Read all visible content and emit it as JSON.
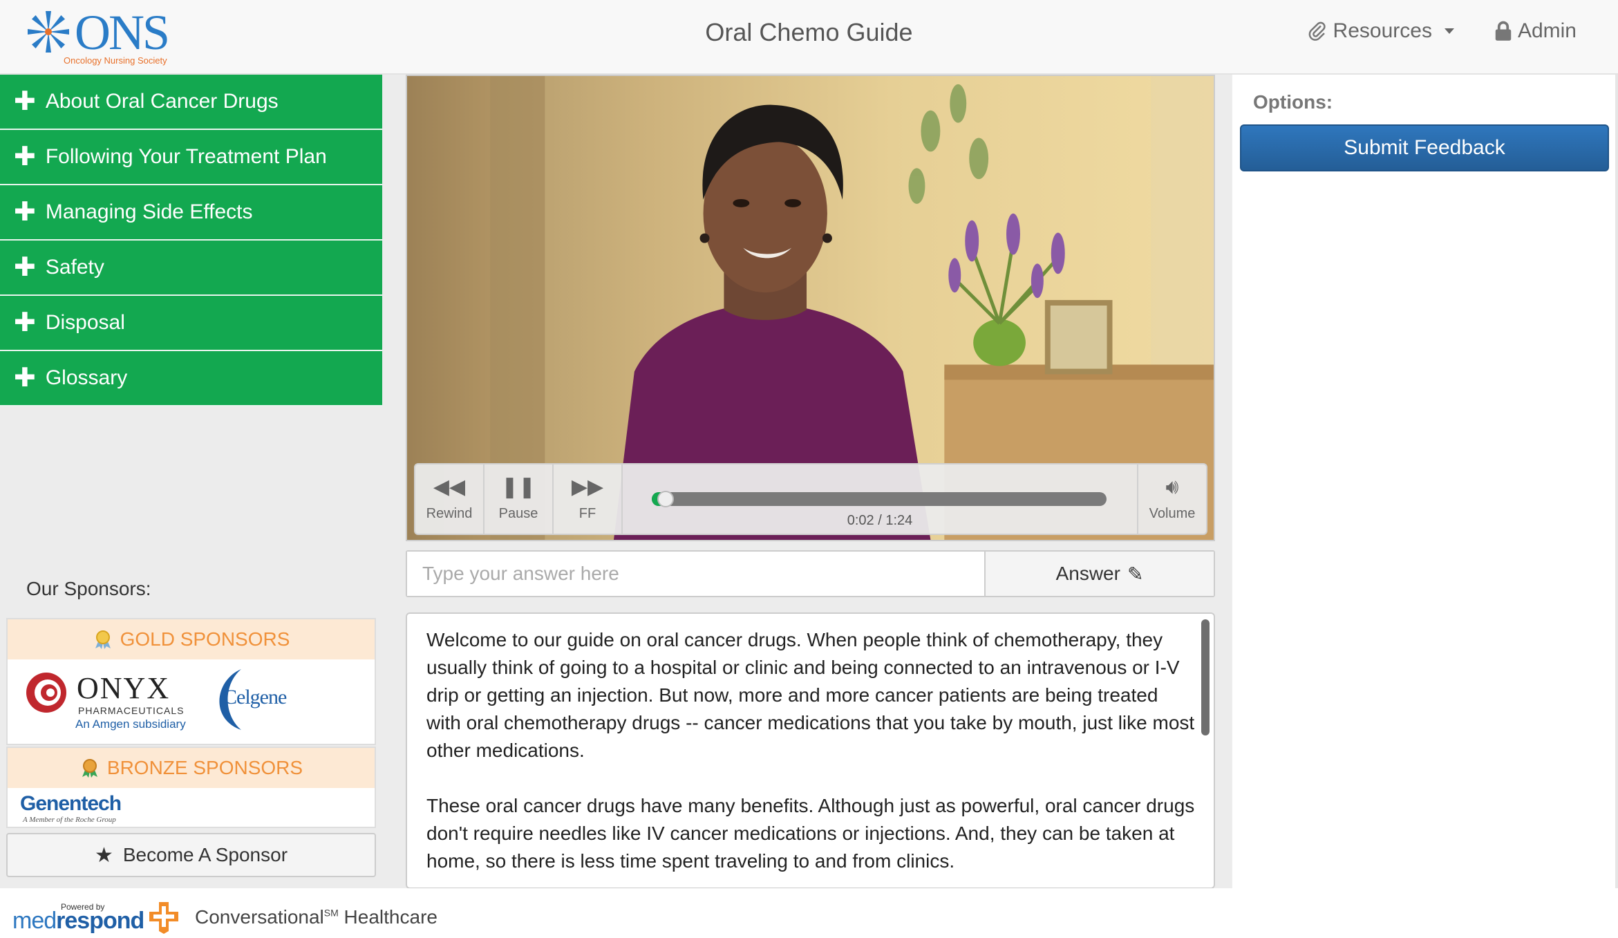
{
  "header": {
    "logo_text": "ONS",
    "logo_subtitle": "Oncology Nursing Society",
    "title": "Oral Chemo Guide",
    "nav": [
      {
        "label": "Resources",
        "icon": "paperclip-icon"
      },
      {
        "label": "Admin",
        "icon": "lock-icon"
      }
    ]
  },
  "sidebar": {
    "menu": [
      {
        "label": "About Oral Cancer Drugs"
      },
      {
        "label": "Following Your Treatment Plan"
      },
      {
        "label": "Managing Side Effects"
      },
      {
        "label": "Safety"
      },
      {
        "label": "Disposal"
      },
      {
        "label": "Glossary"
      }
    ],
    "sponsors_label": "Our Sponsors:",
    "gold_label": "GOLD SPONSORS",
    "bronze_label": "BRONZE SPONSORS",
    "gold_sponsors": [
      {
        "name": "ONYX",
        "line2": "PHARMACEUTICALS",
        "line3": "An Amgen subsidiary"
      },
      {
        "name": "Celgene"
      }
    ],
    "bronze_sponsors": [
      {
        "name": "Genentech",
        "line2": "A Member of the Roche Group"
      }
    ],
    "become_sponsor": "Become A Sponsor"
  },
  "player": {
    "controls": {
      "rewind": "Rewind",
      "pause": "Pause",
      "ff": "FF",
      "volume": "Volume"
    },
    "time": "0:02 / 1:24",
    "progress": 0.024
  },
  "answer": {
    "placeholder": "Type your answer here",
    "button": "Answer"
  },
  "transcript": [
    "Welcome to our guide on oral cancer drugs. When people think of chemotherapy, they usually think of going to a hospital or clinic and being connected to an intravenous or I-V drip or getting an injection. But now, more and more cancer patients are being treated with oral chemotherapy drugs -- cancer medications that you take by mouth, just like most other medications.",
    "These oral cancer drugs have many benefits. Although just as powerful, oral cancer drugs don't require needles like IV cancer medications or injections. And, they can be taken at home, so there is less time spent traveling to and from clinics."
  ],
  "options": {
    "label": "Options:",
    "submit_feedback": "Submit Feedback"
  },
  "footer": {
    "powered_by": "Powered by",
    "brand_med": "med",
    "brand_respond": "respond",
    "tagline": "Conversational",
    "tagline_sup": "SM",
    "tagline_tail": " Healthcare"
  },
  "colors": {
    "menu_green": "#13a850",
    "submit_blue": "#2a6cad",
    "sponsor_orange": "#f0913a"
  }
}
